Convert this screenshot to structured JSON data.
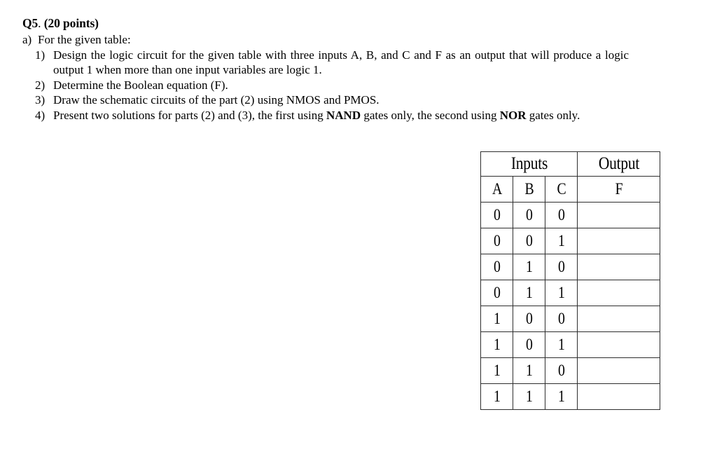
{
  "question": {
    "label_bold": "Q5",
    "label_sep": ".",
    "points": "(20 points)",
    "part_a_marker": "a)",
    "part_a_text": "For the given table:",
    "items": [
      {
        "marker": "1)",
        "text": "Design the logic circuit for the given table with three inputs A, B, and C and F as an output that will produce a logic output 1 when more than one input variables are logic 1."
      },
      {
        "marker": "2)",
        "text": "Determine the Boolean equation (F)."
      },
      {
        "marker": "3)",
        "text": "Draw the schematic circuits of the part (2) using NMOS and PMOS."
      },
      {
        "marker": "4)",
        "text_part1": "Present two solutions for parts (2) and (3), the first using ",
        "bold1": "NAND",
        "text_part2": " gates only, the second using ",
        "bold2": "NOR",
        "text_part3": " gates only."
      }
    ]
  },
  "truth_table": {
    "group_headers": [
      "Inputs",
      "Output"
    ],
    "columns": [
      "A",
      "B",
      "C",
      "F"
    ],
    "rows": [
      {
        "A": "0",
        "B": "0",
        "C": "0",
        "F": ""
      },
      {
        "A": "0",
        "B": "0",
        "C": "1",
        "F": ""
      },
      {
        "A": "0",
        "B": "1",
        "C": "0",
        "F": ""
      },
      {
        "A": "0",
        "B": "1",
        "C": "1",
        "F": ""
      },
      {
        "A": "1",
        "B": "0",
        "C": "0",
        "F": ""
      },
      {
        "A": "1",
        "B": "0",
        "C": "1",
        "F": ""
      },
      {
        "A": "1",
        "B": "1",
        "C": "0",
        "F": ""
      },
      {
        "A": "1",
        "B": "1",
        "C": "1",
        "F": ""
      }
    ]
  },
  "colors": {
    "page_background": "#ffffff",
    "text": "#000000",
    "table_border": "#2e2e2e"
  }
}
